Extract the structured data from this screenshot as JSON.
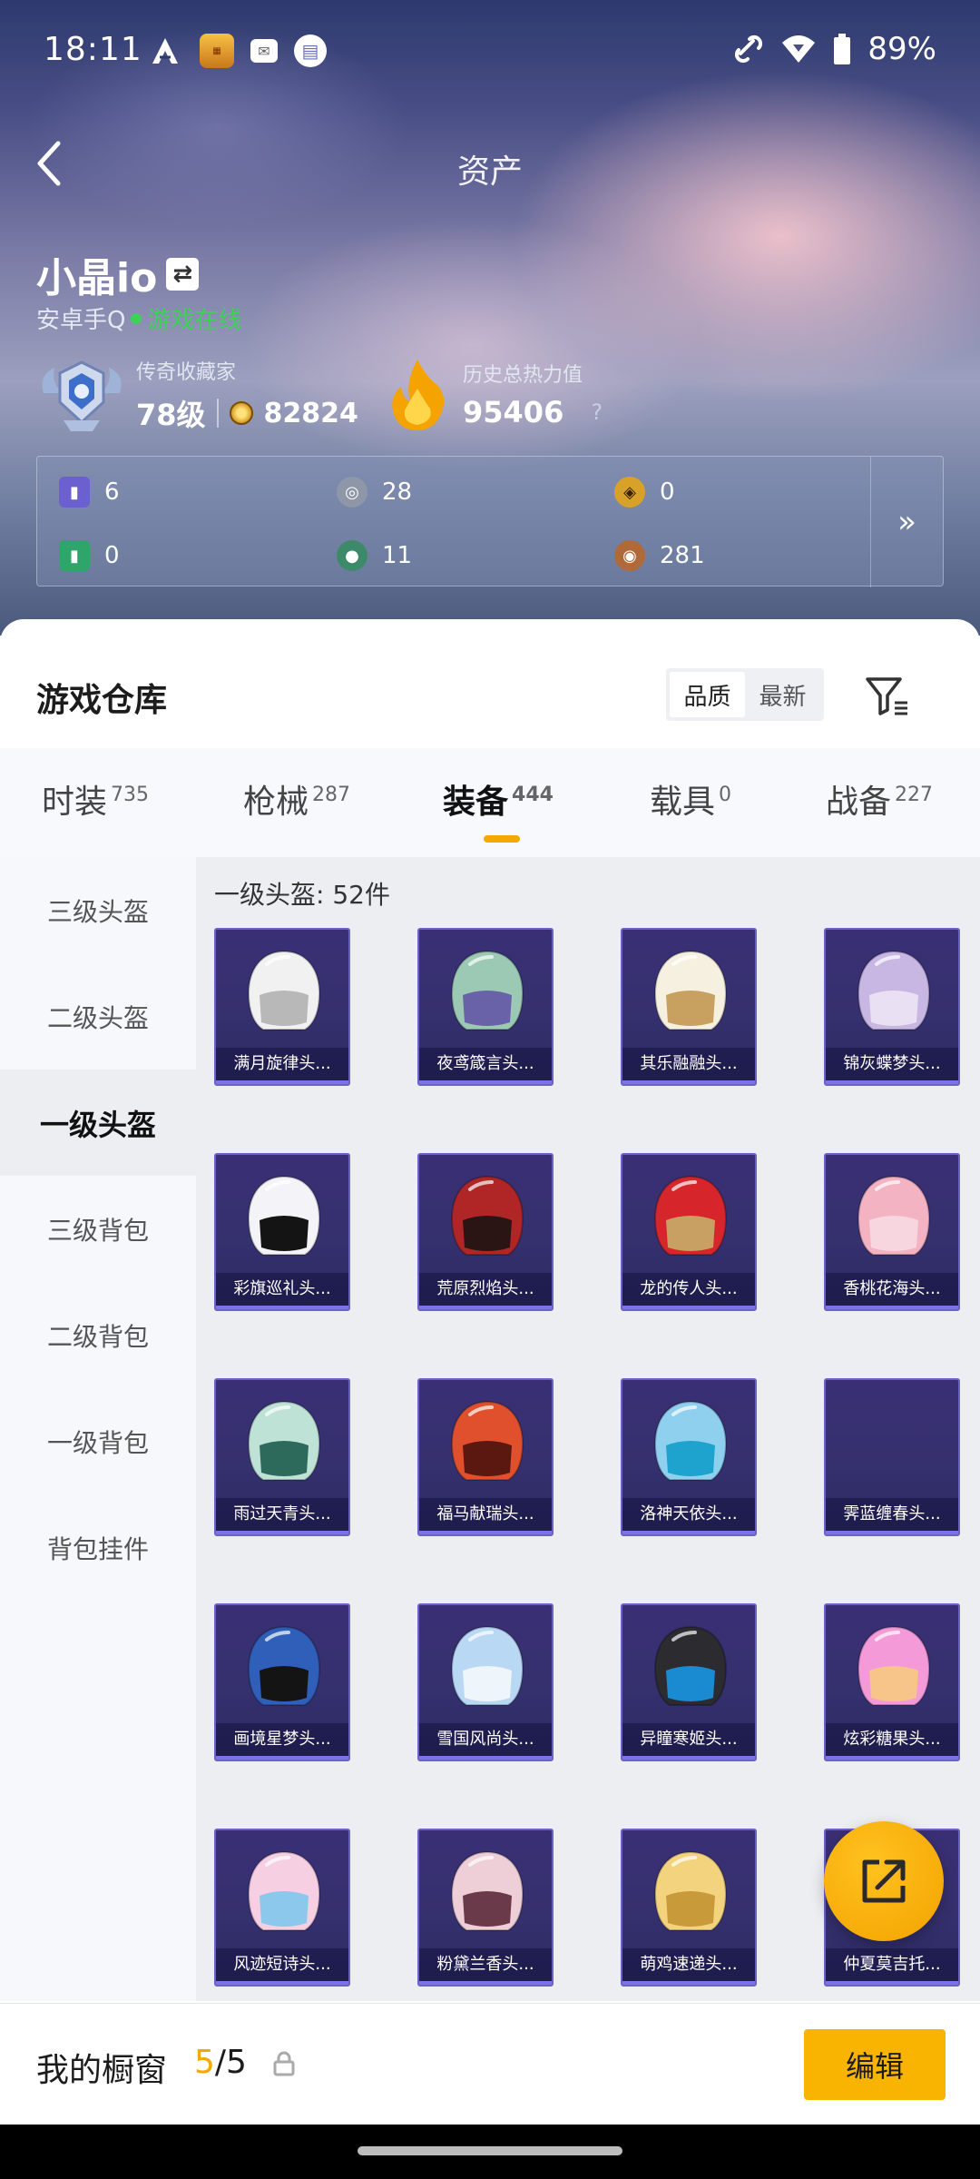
{
  "status": {
    "time": "18:11",
    "battery": "89%",
    "icons": [
      "a-icon",
      "game-app-icon",
      "mail-icon",
      "calendar-icon",
      "link-icon",
      "wifi-icon",
      "battery-icon"
    ]
  },
  "nav": {
    "title": "资产"
  },
  "user": {
    "name": "小晶io",
    "platform": "安卓手Q",
    "online": "游戏在线",
    "rank_title": "传奇收藏家",
    "level": "78级",
    "coins": "82824",
    "heat_title": "历史总热力值",
    "heat_value": "95406",
    "heat_help": "?"
  },
  "assets": [
    {
      "icon": "purple-card-icon",
      "value": "6",
      "color": "#6c5fcf"
    },
    {
      "icon": "silver-coin-icon",
      "value": "28",
      "color": "#8d97a8"
    },
    {
      "icon": "gold-token-icon",
      "value": "0",
      "color": "#d8a22a"
    },
    {
      "icon": "green-card-icon",
      "value": "0",
      "color": "#2fa46b"
    },
    {
      "icon": "green-orb-icon",
      "value": "11",
      "color": "#3d8a6a"
    },
    {
      "icon": "bronze-coin-icon",
      "value": "281",
      "color": "#b06a3a"
    }
  ],
  "warehouse": {
    "title": "游戏仓库",
    "sort": [
      "品质",
      "最新"
    ],
    "tabs": [
      {
        "label": "时装",
        "count": "735"
      },
      {
        "label": "枪械",
        "count": "287"
      },
      {
        "label": "装备",
        "count": "444"
      },
      {
        "label": "载具",
        "count": "0"
      },
      {
        "label": "战备",
        "count": "227"
      }
    ],
    "active_tab": "装备",
    "categories": [
      "三级头盔",
      "二级头盔",
      "一级头盔",
      "三级背包",
      "二级背包",
      "一级背包",
      "背包挂件"
    ],
    "active_category": "一级头盔",
    "grid_header": "一级头盔: 52件",
    "items": [
      {
        "name": "满月旋律头...",
        "color": "#f1f1f1",
        "visor": "#b8b8b8"
      },
      {
        "name": "夜鸢箴言头...",
        "color": "#9cc9b4",
        "visor": "#6a62a9"
      },
      {
        "name": "其乐融融头...",
        "color": "#f5f0e0",
        "visor": "#c8a060"
      },
      {
        "name": "锦灰蝶梦头...",
        "color": "#c9b7e3",
        "visor": "#e9e0f3"
      },
      {
        "name": "彩旗巡礼头...",
        "color": "#f4f4f8",
        "visor": "#141414"
      },
      {
        "name": "荒原烈焰头...",
        "color": "#b02626",
        "visor": "#2a1414"
      },
      {
        "name": "龙的传人头...",
        "color": "#d6262c",
        "visor": "#c9a064"
      },
      {
        "name": "香桃花海头...",
        "color": "#f3b3c2",
        "visor": "#f7d6df"
      },
      {
        "name": "雨过天青头...",
        "color": "#bfe2d6",
        "visor": "#2e6a5c"
      },
      {
        "name": "福马献瑞头...",
        "color": "#e0502c",
        "visor": "#5a1810"
      },
      {
        "name": "洛神天依头...",
        "color": "#8fd0ef",
        "visor": "#1ea3cf"
      },
      {
        "name": "霁蓝缠春头...",
        "color": "",
        "visor": ""
      },
      {
        "name": "画境星梦头...",
        "color": "#2f5fb8",
        "visor": "#141414"
      },
      {
        "name": "雪国风尚头...",
        "color": "#b9d8f4",
        "visor": "#eef5fb"
      },
      {
        "name": "异瞳寒姬头...",
        "color": "#2b2b30",
        "visor": "#1a8bd0"
      },
      {
        "name": "炫彩糖果头...",
        "color": "#f59ad8",
        "visor": "#f7c48a"
      },
      {
        "name": "风迹短诗头...",
        "color": "#f6cfe2",
        "visor": "#8cc7ec"
      },
      {
        "name": "粉黛兰香头...",
        "color": "#eecfd8",
        "visor": "#6a3a4a"
      },
      {
        "name": "萌鸡速递头...",
        "color": "#f3d37e",
        "visor": "#c99a3a"
      },
      {
        "name": "仲夏莫吉托...",
        "color": "",
        "visor": ""
      }
    ]
  },
  "showcase": {
    "label": "我的橱窗",
    "used": "5",
    "total": "5",
    "edit": "编辑"
  }
}
